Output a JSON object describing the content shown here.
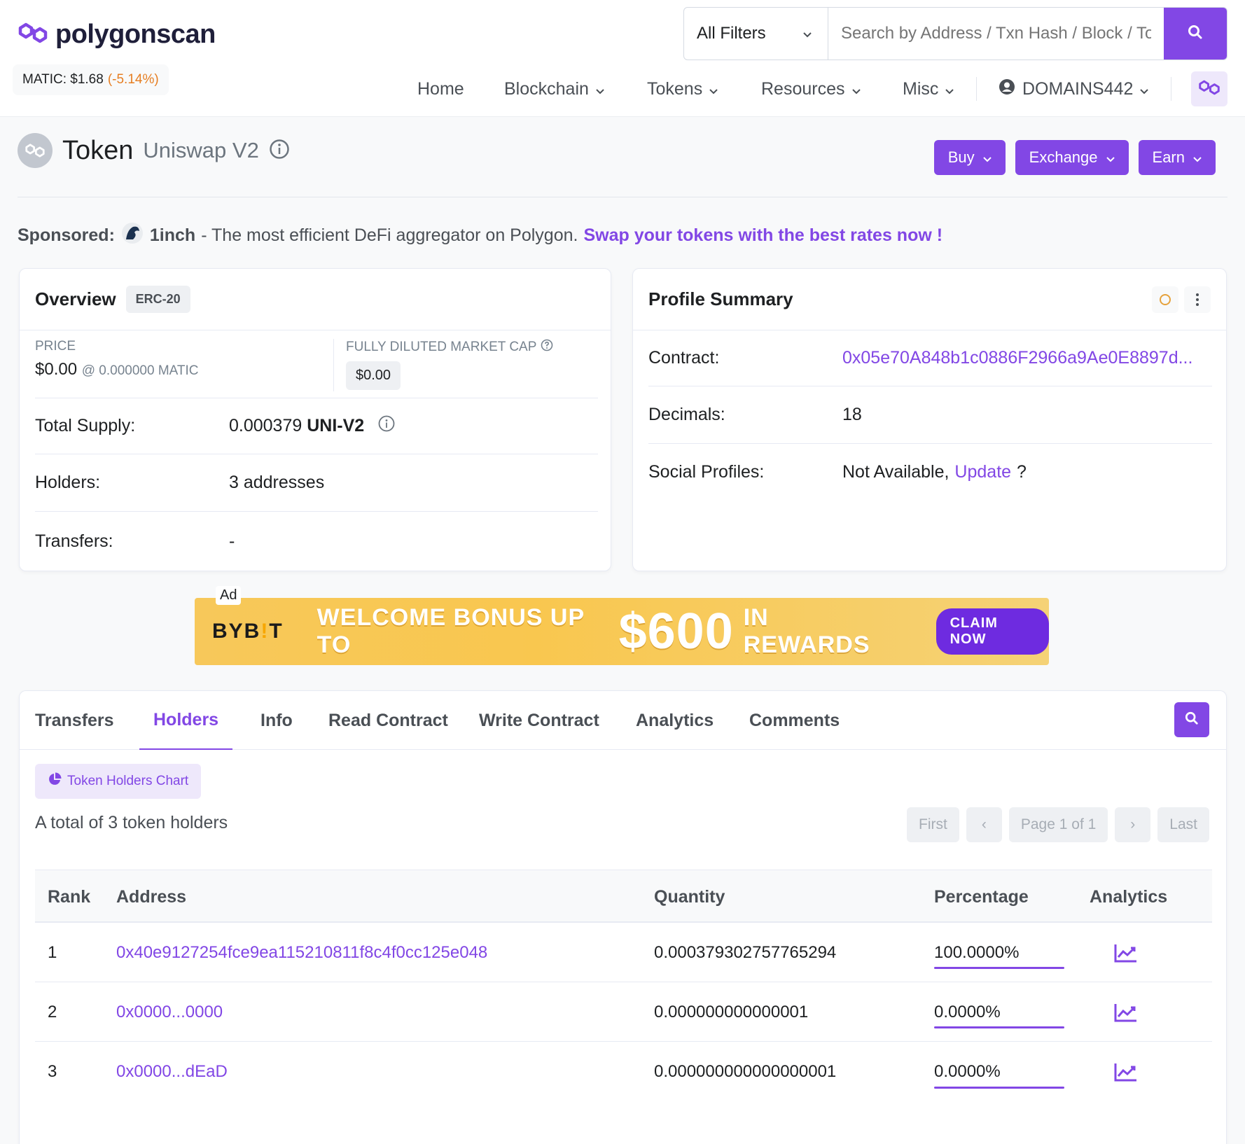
{
  "header": {
    "logo_text": "polygonscan",
    "price_label": "MATIC: $1.68",
    "price_change": "(-5.14%)",
    "filter_label": "All Filters",
    "search_placeholder": "Search by Address / Txn Hash / Block / Token",
    "nav": [
      "Home",
      "Blockchain",
      "Tokens",
      "Resources",
      "Misc"
    ],
    "user": "DOMAINS442"
  },
  "page": {
    "title": "Token",
    "subtitle": "Uniswap V2",
    "buttons": [
      "Buy",
      "Exchange",
      "Earn"
    ]
  },
  "sponsored": {
    "label": "Sponsored:",
    "name": "1inch",
    "dash": " - ",
    "text": "- The most efficient DeFi aggregator on Polygon.",
    "link": "Swap your tokens with the best rates now !"
  },
  "overview": {
    "title": "Overview",
    "badge": "ERC-20",
    "price_label": "PRICE",
    "price_value": "$0.00",
    "price_matic": "@ 0.000000 MATIC",
    "mcap_label": "FULLY DILUTED MARKET CAP",
    "mcap_value": "$0.00",
    "total_supply_label": "Total Supply:",
    "total_supply_value": "0.000379",
    "total_supply_symbol": "UNI-V2",
    "holders_label": "Holders:",
    "holders_value": "3 addresses",
    "transfers_label": "Transfers:",
    "transfers_value": "-"
  },
  "profile": {
    "title": "Profile Summary",
    "contract_label": "Contract:",
    "contract_value": "0x05e70A848b1c0886F2966a9Ae0E8897d...",
    "decimals_label": "Decimals:",
    "decimals_value": "18",
    "social_label": "Social Profiles:",
    "social_value": "Not Available,",
    "social_link": "Update",
    "social_q": "?"
  },
  "ad": {
    "tag": "Ad",
    "brand_left": "BYB",
    "brand_bang": "!",
    "brand_right": "T",
    "msg1": "WELCOME BONUS UP TO",
    "amount": "$600",
    "msg2": "IN REWARDS",
    "cta": "CLAIM NOW"
  },
  "tabs": [
    "Transfers",
    "Holders",
    "Info",
    "Read Contract",
    "Write Contract",
    "Analytics",
    "Comments"
  ],
  "active_tab": "Holders",
  "holders": {
    "chart_button": "Token Holders Chart",
    "total_text": "A total of 3 token holders",
    "pager": {
      "first": "First",
      "prev": "‹",
      "page": "Page 1 of 1",
      "next": "›",
      "last": "Last"
    },
    "columns": [
      "Rank",
      "Address",
      "Quantity",
      "Percentage",
      "Analytics"
    ],
    "rows": [
      {
        "rank": "1",
        "address": "0x40e9127254fce9ea115210811f8c4f0cc125e048",
        "quantity": "0.000379302757765294",
        "percentage": "100.0000%"
      },
      {
        "rank": "2",
        "address": "0x0000...0000",
        "quantity": "0.000000000000001",
        "percentage": "0.0000%"
      },
      {
        "rank": "3",
        "address": "0x0000...dEaD",
        "quantity": "0.000000000000000001",
        "percentage": "0.0000%"
      }
    ]
  },
  "colors": {
    "accent": "#8247e5",
    "negative": "#e67e22"
  }
}
